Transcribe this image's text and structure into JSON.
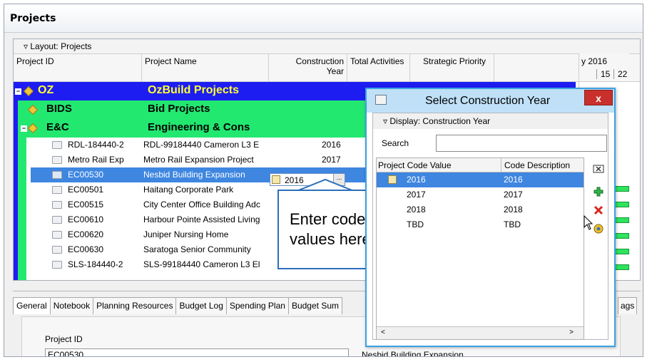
{
  "window": {
    "title": "Projects"
  },
  "layout_label": "Layout: Projects",
  "columns": {
    "project_id": "Project ID",
    "project_name": "Project Name",
    "construction_year_1": "Construction",
    "construction_year_2": "Year",
    "total_activities": "Total Activities",
    "strategic_priority": "Strategic Priority"
  },
  "gantt": {
    "month_label": "y 2016",
    "day1": "15",
    "day2": "22"
  },
  "groups": {
    "oz": {
      "id": "OZ",
      "name": "OzBuild Projects"
    },
    "bids": {
      "id": "BIDS",
      "name": "Bid Projects"
    },
    "ec": {
      "id": "E&C",
      "name": "Engineering & Cons"
    }
  },
  "projects": [
    {
      "id": "RDL-184440-2",
      "name": "RDL-99184440 Cameron L3 E",
      "year": "2016"
    },
    {
      "id": "Metro Rail Exp",
      "name": "Metro Rail Expansion Project",
      "year": "2017"
    },
    {
      "id": "EC00530",
      "name": "Nesbid Building Expansion",
      "year": "2016"
    },
    {
      "id": "EC00501",
      "name": "Haitang Corporate Park",
      "year": ""
    },
    {
      "id": "EC00515",
      "name": "City Center Office Building Adc",
      "year": ""
    },
    {
      "id": "EC00610",
      "name": "Harbour Pointe Assisted Living",
      "year": ""
    },
    {
      "id": "EC00620",
      "name": "Juniper Nursing Home",
      "year": ""
    },
    {
      "id": "EC00630",
      "name": "Saratoga Senior Community",
      "year": ""
    },
    {
      "id": "SLS-184440-2",
      "name": "SLS-99184440 Cameron L3 El",
      "year": ""
    }
  ],
  "edit_cell": {
    "value": "2016",
    "button": "..."
  },
  "callout": {
    "line1": "Enter codes",
    "line2": "values here"
  },
  "tabs": [
    "General",
    "Notebook",
    "Planning Resources",
    "Budget Log",
    "Spending Plan",
    "Budget Sum"
  ],
  "tab_right": "ags",
  "form": {
    "project_id_label": "Project ID",
    "project_id_value": "EC00530",
    "project_name_value": "Nesbid Building Expansion"
  },
  "dialog": {
    "title": "Select Construction Year",
    "close": "x",
    "display_label": "Display: Construction Year",
    "search_label": "Search",
    "search_value": "",
    "col_value": "Project Code Value",
    "col_desc": "Code Description",
    "rows": [
      {
        "value": "2016",
        "desc": "2016"
      },
      {
        "value": "2017",
        "desc": "2017"
      },
      {
        "value": "2018",
        "desc": "2018"
      },
      {
        "value": "TBD",
        "desc": "TBD"
      }
    ],
    "scroll_left": "<",
    "scroll_right": ">"
  },
  "colors": {
    "group_oz_bg": "#1d1df2",
    "group_oz_text": "#ffff33",
    "group_green": "#22e870",
    "selection": "#3e86e0",
    "callout_border": "#2c6fbb",
    "dialog_title_bg": "#bfe0f7",
    "close_red": "#c9302c"
  }
}
